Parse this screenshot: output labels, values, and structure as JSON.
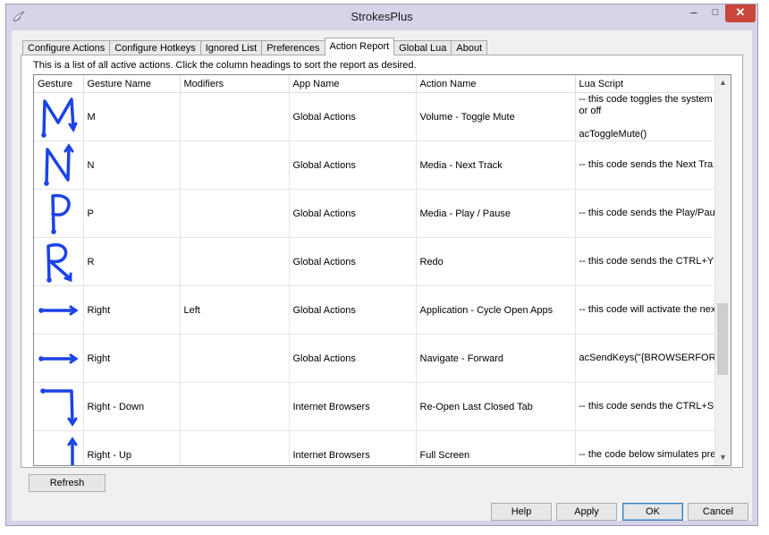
{
  "window": {
    "title": "StrokesPlus",
    "minimize": "–",
    "maximize": "□",
    "close": "✕"
  },
  "tabs": [
    {
      "label": "Configure Actions"
    },
    {
      "label": "Configure Hotkeys"
    },
    {
      "label": "Ignored List"
    },
    {
      "label": "Preferences"
    },
    {
      "label": "Action Report",
      "active": true
    },
    {
      "label": "Global Lua"
    },
    {
      "label": "About"
    }
  ],
  "report": {
    "description": "This is a list of all active actions.  Click the column headings to sort the report as desired.",
    "columns": [
      "Gesture",
      "Gesture Name",
      "Modifiers",
      "App Name",
      "Action Name",
      "Lua Script"
    ],
    "rows": [
      {
        "gesture_icon": "gesture-m-icon",
        "gesture_name": "M",
        "modifiers": "",
        "app_name": "Global Actions",
        "action_name": "Volume - Toggle Mute",
        "lua_script": [
          "-- this code toggles the system Mute on",
          "or off",
          "",
          "acToggleMute()"
        ]
      },
      {
        "gesture_icon": "gesture-n-icon",
        "gesture_name": "N",
        "modifiers": "",
        "app_name": "Global Actions",
        "action_name": "Media - Next Track",
        "lua_script": [
          "-- this code sends the Next Track key..."
        ]
      },
      {
        "gesture_icon": "gesture-p-icon",
        "gesture_name": "P",
        "modifiers": "",
        "app_name": "Global Actions",
        "action_name": "Media - Play / Pause",
        "lua_script": [
          "-- this code sends the Play/Pause key..."
        ]
      },
      {
        "gesture_icon": "gesture-r-icon",
        "gesture_name": "R",
        "modifiers": "",
        "app_name": "Global Actions",
        "action_name": "Redo",
        "lua_script": [
          "-- this code sends the CTRL+Y key co..."
        ]
      },
      {
        "gesture_icon": "gesture-right-arrow-icon",
        "gesture_name": "Right",
        "modifiers": "Left",
        "app_name": "Global Actions",
        "action_name": "Application - Cycle Open Apps",
        "lua_script": [
          "-- this code will activate the next win..."
        ]
      },
      {
        "gesture_icon": "gesture-right-arrow-icon",
        "gesture_name": "Right",
        "modifiers": "",
        "app_name": "Global Actions",
        "action_name": "Navigate - Forward",
        "lua_script": [
          "acSendKeys(\"{BROWSERFORWARD}\")"
        ]
      },
      {
        "gesture_icon": "gesture-right-down-icon",
        "gesture_name": "Right - Down",
        "modifiers": "",
        "app_name": "Internet Browsers",
        "action_name": "Re-Open Last Closed Tab",
        "lua_script": [
          "-- this code sends the CTRL+SHIFT+..."
        ]
      },
      {
        "gesture_icon": "gesture-right-up-icon",
        "gesture_name": "Right - Up",
        "modifiers": "",
        "app_name": "Internet Browsers",
        "action_name": "Full Screen",
        "lua_script": [
          "-- the code below simulates pressing t..."
        ]
      }
    ]
  },
  "buttons": {
    "refresh": "Refresh",
    "help": "Help",
    "apply": "Apply",
    "ok": "OK",
    "cancel": "Cancel"
  },
  "colors": {
    "gesture_stroke": "#1b43e6",
    "frame": "#d6d4e8",
    "close_button": "#c8463a"
  }
}
